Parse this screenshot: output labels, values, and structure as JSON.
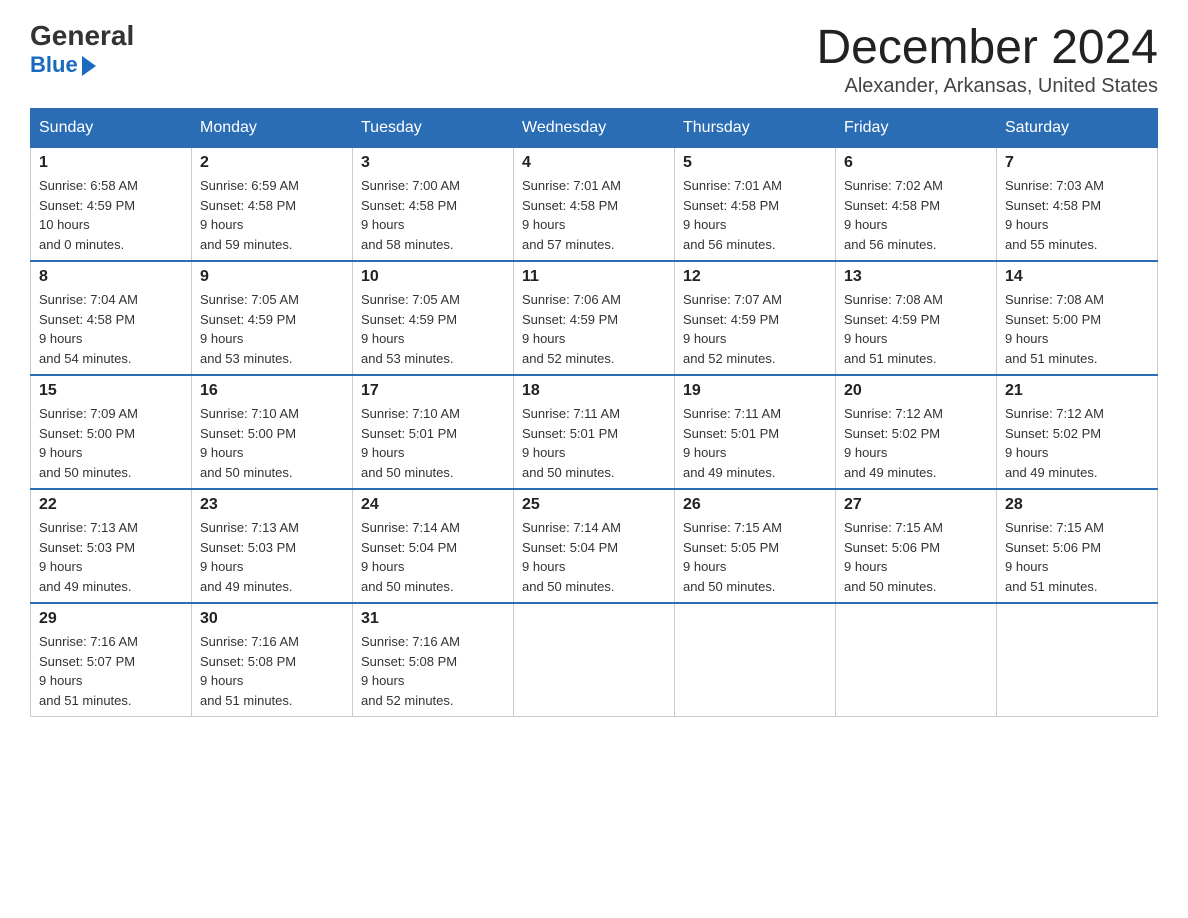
{
  "logo": {
    "general": "General",
    "blue": "Blue"
  },
  "header": {
    "month": "December 2024",
    "location": "Alexander, Arkansas, United States"
  },
  "weekdays": [
    "Sunday",
    "Monday",
    "Tuesday",
    "Wednesday",
    "Thursday",
    "Friday",
    "Saturday"
  ],
  "weeks": [
    [
      {
        "day": "1",
        "sunrise": "6:58 AM",
        "sunset": "4:59 PM",
        "daylight": "10 hours and 0 minutes."
      },
      {
        "day": "2",
        "sunrise": "6:59 AM",
        "sunset": "4:58 PM",
        "daylight": "9 hours and 59 minutes."
      },
      {
        "day": "3",
        "sunrise": "7:00 AM",
        "sunset": "4:58 PM",
        "daylight": "9 hours and 58 minutes."
      },
      {
        "day": "4",
        "sunrise": "7:01 AM",
        "sunset": "4:58 PM",
        "daylight": "9 hours and 57 minutes."
      },
      {
        "day": "5",
        "sunrise": "7:01 AM",
        "sunset": "4:58 PM",
        "daylight": "9 hours and 56 minutes."
      },
      {
        "day": "6",
        "sunrise": "7:02 AM",
        "sunset": "4:58 PM",
        "daylight": "9 hours and 56 minutes."
      },
      {
        "day": "7",
        "sunrise": "7:03 AM",
        "sunset": "4:58 PM",
        "daylight": "9 hours and 55 minutes."
      }
    ],
    [
      {
        "day": "8",
        "sunrise": "7:04 AM",
        "sunset": "4:58 PM",
        "daylight": "9 hours and 54 minutes."
      },
      {
        "day": "9",
        "sunrise": "7:05 AM",
        "sunset": "4:59 PM",
        "daylight": "9 hours and 53 minutes."
      },
      {
        "day": "10",
        "sunrise": "7:05 AM",
        "sunset": "4:59 PM",
        "daylight": "9 hours and 53 minutes."
      },
      {
        "day": "11",
        "sunrise": "7:06 AM",
        "sunset": "4:59 PM",
        "daylight": "9 hours and 52 minutes."
      },
      {
        "day": "12",
        "sunrise": "7:07 AM",
        "sunset": "4:59 PM",
        "daylight": "9 hours and 52 minutes."
      },
      {
        "day": "13",
        "sunrise": "7:08 AM",
        "sunset": "4:59 PM",
        "daylight": "9 hours and 51 minutes."
      },
      {
        "day": "14",
        "sunrise": "7:08 AM",
        "sunset": "5:00 PM",
        "daylight": "9 hours and 51 minutes."
      }
    ],
    [
      {
        "day": "15",
        "sunrise": "7:09 AM",
        "sunset": "5:00 PM",
        "daylight": "9 hours and 50 minutes."
      },
      {
        "day": "16",
        "sunrise": "7:10 AM",
        "sunset": "5:00 PM",
        "daylight": "9 hours and 50 minutes."
      },
      {
        "day": "17",
        "sunrise": "7:10 AM",
        "sunset": "5:01 PM",
        "daylight": "9 hours and 50 minutes."
      },
      {
        "day": "18",
        "sunrise": "7:11 AM",
        "sunset": "5:01 PM",
        "daylight": "9 hours and 50 minutes."
      },
      {
        "day": "19",
        "sunrise": "7:11 AM",
        "sunset": "5:01 PM",
        "daylight": "9 hours and 49 minutes."
      },
      {
        "day": "20",
        "sunrise": "7:12 AM",
        "sunset": "5:02 PM",
        "daylight": "9 hours and 49 minutes."
      },
      {
        "day": "21",
        "sunrise": "7:12 AM",
        "sunset": "5:02 PM",
        "daylight": "9 hours and 49 minutes."
      }
    ],
    [
      {
        "day": "22",
        "sunrise": "7:13 AM",
        "sunset": "5:03 PM",
        "daylight": "9 hours and 49 minutes."
      },
      {
        "day": "23",
        "sunrise": "7:13 AM",
        "sunset": "5:03 PM",
        "daylight": "9 hours and 49 minutes."
      },
      {
        "day": "24",
        "sunrise": "7:14 AM",
        "sunset": "5:04 PM",
        "daylight": "9 hours and 50 minutes."
      },
      {
        "day": "25",
        "sunrise": "7:14 AM",
        "sunset": "5:04 PM",
        "daylight": "9 hours and 50 minutes."
      },
      {
        "day": "26",
        "sunrise": "7:15 AM",
        "sunset": "5:05 PM",
        "daylight": "9 hours and 50 minutes."
      },
      {
        "day": "27",
        "sunrise": "7:15 AM",
        "sunset": "5:06 PM",
        "daylight": "9 hours and 50 minutes."
      },
      {
        "day": "28",
        "sunrise": "7:15 AM",
        "sunset": "5:06 PM",
        "daylight": "9 hours and 51 minutes."
      }
    ],
    [
      {
        "day": "29",
        "sunrise": "7:16 AM",
        "sunset": "5:07 PM",
        "daylight": "9 hours and 51 minutes."
      },
      {
        "day": "30",
        "sunrise": "7:16 AM",
        "sunset": "5:08 PM",
        "daylight": "9 hours and 51 minutes."
      },
      {
        "day": "31",
        "sunrise": "7:16 AM",
        "sunset": "5:08 PM",
        "daylight": "9 hours and 52 minutes."
      },
      null,
      null,
      null,
      null
    ]
  ]
}
